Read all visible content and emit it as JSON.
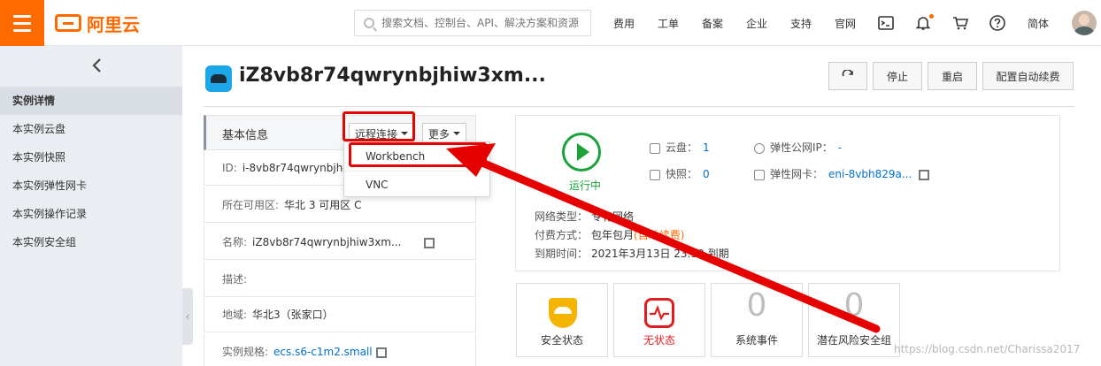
{
  "topbar": {
    "logo_text": "阿里云",
    "search_placeholder": "搜索文档、控制台、API、解决方案和资源",
    "nav": [
      "费用",
      "工单",
      "备案",
      "企业",
      "支持",
      "官网"
    ],
    "lang": "简体",
    "brand_color": "#ff6a00"
  },
  "sidebar": {
    "items": [
      "实例详情",
      "本实例云盘",
      "本实例快照",
      "本实例弹性网卡",
      "本实例操作记录",
      "本实例安全组"
    ],
    "active_index": 0
  },
  "header": {
    "title": "iZ8vb8r74qwrynbjhiw3xm...",
    "buttons": [
      "停止",
      "重启",
      "配置自动续费"
    ]
  },
  "basic_info": {
    "title": "基本信息",
    "remote_label": "远程连接",
    "more_label": "更多",
    "rows": [
      {
        "label": "ID:",
        "value": "i-8vb8r74qwrynbjhiw"
      },
      {
        "label": "所在可用区:",
        "value": "华北 3 可用区 C"
      },
      {
        "label": "名称:",
        "value": "iZ8vb8r74qwrynbjhiw3xm..."
      },
      {
        "label": "描述:",
        "value": ""
      },
      {
        "label": "地域:",
        "value": "华北3（张家口）"
      },
      {
        "label": "实例规格:",
        "value": "ecs.s6-c1m2.small"
      }
    ]
  },
  "dropdown": {
    "items": [
      "Workbench",
      "VNC"
    ]
  },
  "status": {
    "state": "运行中",
    "disk_label": "云盘：",
    "disk_value": "1",
    "snapshot_label": "快照：",
    "snapshot_value": "0",
    "eip_label": "弹性公网IP：",
    "eip_value": "-",
    "eni_label": "弹性网卡：",
    "eni_value": "eni-8vbh829a...",
    "network_label": "网络类型：",
    "network_value": "专有网络",
    "pay_label": "付费方式：",
    "pay_value": "包年包月",
    "pay_note": "(自动续费)",
    "expire_label": "到期时间：",
    "expire_value": "2021年3月13日 23:59 到期"
  },
  "cards": [
    {
      "label": "安全状态",
      "value": ""
    },
    {
      "label": "无状态",
      "value": ""
    },
    {
      "label": "系统事件",
      "value": "0"
    },
    {
      "label": "潜在风险安全组",
      "value": "0"
    }
  ],
  "watermark": "https://blog.csdn.net/Charissa2017",
  "annotation_color": "#e60000"
}
